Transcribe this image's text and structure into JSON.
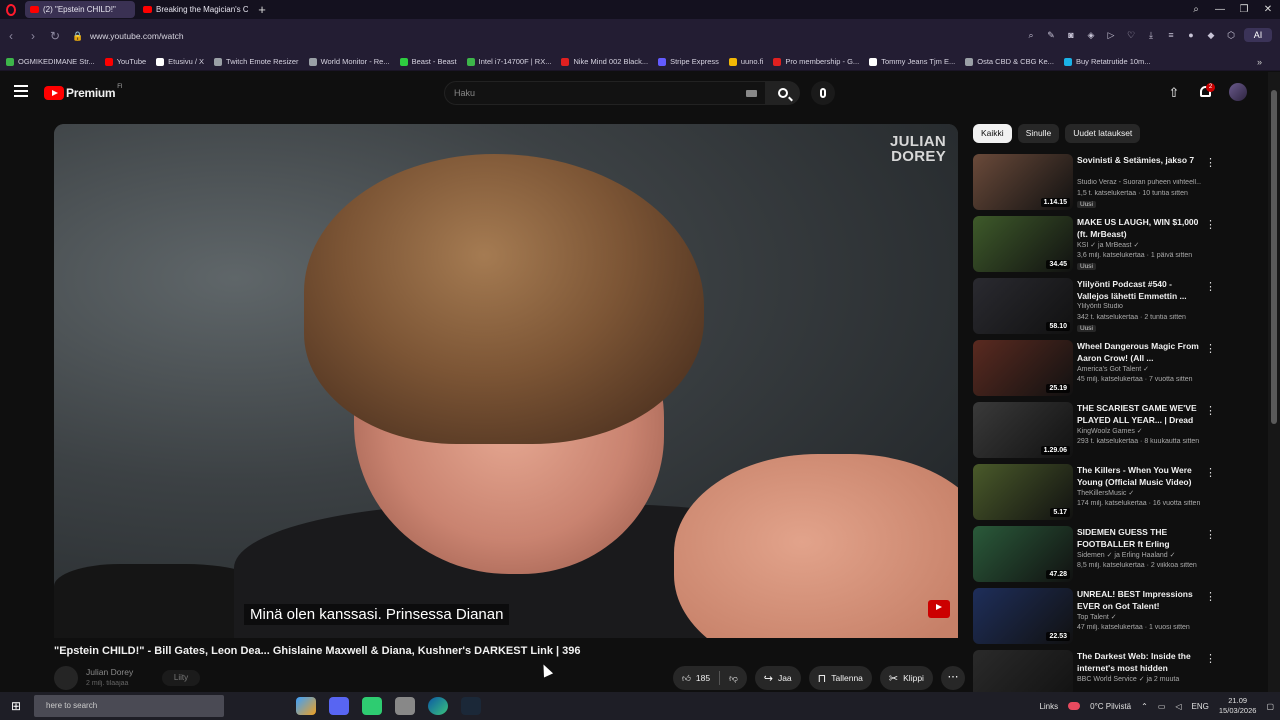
{
  "browser": {
    "tabs": [
      {
        "label": "(2) \"Epstein CHILD!\"",
        "active": true
      },
      {
        "label": "Breaking the Magician's C",
        "active": false
      }
    ],
    "url": "www.youtube.com/watch",
    "ai_label": "AI",
    "bookmarks": [
      {
        "label": "OGMIKEDIMANE Str...",
        "color": "#3db54a"
      },
      {
        "label": "YouTube",
        "color": "#ff0000"
      },
      {
        "label": "Etusivu / X",
        "color": "#ffffff"
      },
      {
        "label": "Twitch Emote Resizer",
        "color": "#9aa0a6"
      },
      {
        "label": "World Monitor - Re...",
        "color": "#9aa0a6"
      },
      {
        "label": "Beast - Beast",
        "color": "#2ecc40"
      },
      {
        "label": "Intel i7-14700F | RX...",
        "color": "#3db54a"
      },
      {
        "label": "Nike Mind 002 Black...",
        "color": "#e02020"
      },
      {
        "label": "Stripe Express",
        "color": "#635bff"
      },
      {
        "label": "uuno.fi",
        "color": "#f2b705"
      },
      {
        "label": "Pro membership - G...",
        "color": "#e02020"
      },
      {
        "label": "Tommy Jeans Tjm E...",
        "color": "#ffffff"
      },
      {
        "label": "Osta CBD & CBG Ke...",
        "color": "#9aa0a6"
      },
      {
        "label": "Buy Retatrutide 10m...",
        "color": "#1ab2e8"
      }
    ]
  },
  "youtube": {
    "logo_text": "Premium",
    "logo_region": "FI",
    "search_placeholder": "Haku",
    "notification_count": "2"
  },
  "player": {
    "watermark_line1": "JULIAN",
    "watermark_line2": "DOREY",
    "subtitle": "Minä olen kanssasi.  Prinsessa Dianan"
  },
  "video": {
    "title": "\"Epstein CHILD!\" - Bill Gates, Leon Dea... Ghislaine Maxwell & Diana, Kushner's DARKEST Link | 396",
    "channel": "Julian Dorey",
    "subscribers": "2 milj. tilaajaa",
    "join_label": "Liity",
    "like_count": "185",
    "share_label": "Jaa",
    "save_label": "Tallenna",
    "clip_label": "Klippi"
  },
  "sidebar": {
    "chips": [
      {
        "label": "Kaikki",
        "active": true
      },
      {
        "label": "Sinulle",
        "active": false
      },
      {
        "label": "Uudet lataukset",
        "active": false
      }
    ],
    "recommendations": [
      {
        "title": "Sovinisti & Setämies, jakso 7",
        "channel": "Studio Veraz - Suoran puheen viihteell...",
        "meta": "1,5 t. katselukertaa · 10 tuntia sitten",
        "badge": "Uusi",
        "duration": "1.14.15",
        "thumb_color": "#6a4a3a"
      },
      {
        "title": "MAKE US LAUGH, WIN $1,000 (ft. MrBeast)",
        "channel": "KSI ✓ ja MrBeast ✓",
        "meta": "3,6 milj. katselukertaa · 1 päivä sitten",
        "badge": "Uusi",
        "duration": "34.45",
        "thumb_color": "#3e5a2a"
      },
      {
        "title": "Ylilyönti Podcast #540 - Vallejos lähetti Emmettin ...",
        "channel": "Ylilyönti Studio",
        "meta": "342 t. katselukertaa · 2 tuntia sitten",
        "badge": "Uusi",
        "duration": "58.10",
        "thumb_color": "#2a2a30"
      },
      {
        "title": "Wheel Dangerous Magic From Aaron Crow! (All ...",
        "channel": "America's Got Talent ✓",
        "meta": "45 milj. katselukertaa · 7 vuotta sitten",
        "badge": "",
        "duration": "25.19",
        "thumb_color": "#5a2a20"
      },
      {
        "title": "THE SCARIEST GAME WE'VE PLAYED ALL YEAR... | Dread ...",
        "channel": "KingWoolz Games ✓",
        "meta": "293 t. katselukertaa · 8 kuukautta sitten",
        "badge": "",
        "duration": "1.29.06",
        "thumb_color": "#3a3a3a"
      },
      {
        "title": "The Killers - When You Were Young (Official Music Video)",
        "channel": "TheKillersMusic ✓",
        "meta": "174 milj. katselukertaa · 16 vuotta sitten",
        "badge": "",
        "duration": "5.17",
        "thumb_color": "#4a5a2a"
      },
      {
        "title": "SIDEMEN GUESS THE FOOTBALLER ft Erling Haaland",
        "channel": "Sidemen ✓ ja Erling Haaland ✓",
        "meta": "8,5 milj. katselukertaa · 2 viikkoa sitten",
        "badge": "",
        "duration": "47.28",
        "thumb_color": "#2a5a3a"
      },
      {
        "title": "UNREAL! BEST Impressions EVER on Got Talent!",
        "channel": "Top Talent ✓",
        "meta": "47 milj. katselukertaa · 1 vuosi sitten",
        "badge": "",
        "duration": "22.53",
        "thumb_color": "#1e2e5a"
      },
      {
        "title": "The Darkest Web: Inside the internet's most hidden corner...",
        "channel": "BBC World Service ✓ ja 2 muuta",
        "meta": "",
        "badge": "",
        "duration": "",
        "thumb_color": "#2a2a2a"
      }
    ]
  },
  "taskbar": {
    "search_placeholder": "here to search",
    "links_label": "Links",
    "weather": "0°C Pilvistä",
    "language": "ENG",
    "time": "21.09",
    "date": "15/03/2026"
  }
}
